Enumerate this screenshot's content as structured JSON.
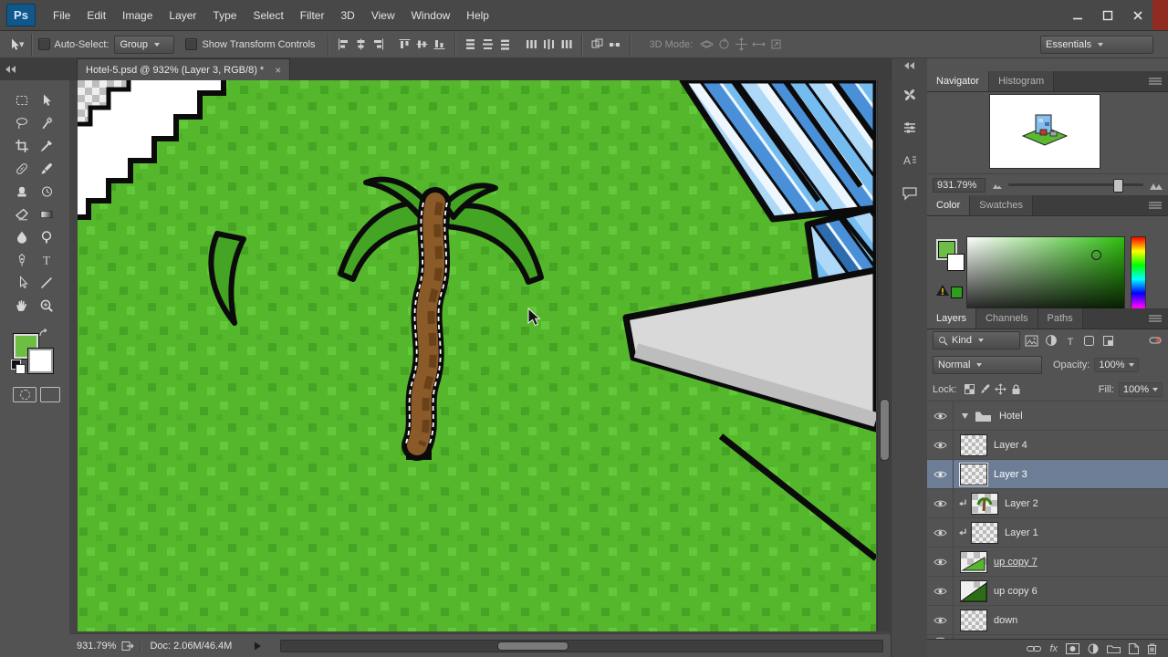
{
  "colors": {
    "grass": "#55b82c",
    "grass_dark": "#47a323",
    "grass_light": "#64c93a",
    "grass_mid": "#4fae27",
    "palm_leaf": "#43a523",
    "trunk": "#8a5a28",
    "trunk_dark": "#6b4118",
    "outline": "#0b0b0b",
    "glass_white": "#eef7fe",
    "glass_light": "#aed8f8",
    "glass_mid": "#74bbf0",
    "glass_deep": "#4a90d8",
    "glass_dark": "#2e6cb0",
    "concrete": "#d9d9d9",
    "concrete_shade": "#bdbdbd",
    "fg_swatch": "#6cbe45",
    "accent_selection": "#6d7d95"
  },
  "menu": {
    "logo": "Ps",
    "items": [
      "File",
      "Edit",
      "Image",
      "Layer",
      "Type",
      "Select",
      "Filter",
      "3D",
      "View",
      "Window",
      "Help"
    ]
  },
  "options": {
    "auto_select": "Auto-Select:",
    "group": "Group",
    "show_transform": "Show Transform Controls",
    "mode_3d": "3D Mode:",
    "workspace": "Essentials"
  },
  "tab": {
    "title": "Hotel-5.psd @ 932% (Layer 3, RGB/8) *",
    "close": "×"
  },
  "tools": [
    "rectangular-marquee",
    "move",
    "lasso",
    "magic-wand",
    "crop",
    "eyedropper",
    "spot-healing",
    "brush",
    "clone-stamp",
    "history-brush",
    "eraser",
    "gradient",
    "blur",
    "dodge",
    "pen",
    "type",
    "path-selection",
    "line",
    "hand",
    "zoom"
  ],
  "side_dock_icons": [
    "pinwheel-icon",
    "sliders-icon",
    "character-panel-icon",
    "notes-icon"
  ],
  "icons": {
    "type_glyph": "T",
    "fx_glyph": "fx"
  },
  "navigator": {
    "tab_navigator": "Navigator",
    "tab_histogram": "Histogram",
    "zoom": "931.79%"
  },
  "color": {
    "tab_color": "Color",
    "tab_swatches": "Swatches"
  },
  "layers": {
    "tab_layers": "Layers",
    "tab_channels": "Channels",
    "tab_paths": "Paths",
    "kind": "Kind",
    "blend_mode": "Normal",
    "opacity_label": "Opacity:",
    "opacity": "100%",
    "lock_label": "Lock:",
    "fill_label": "Fill:",
    "fill": "100%",
    "rows": [
      {
        "name": "Hotel"
      },
      {
        "name": "Layer 4"
      },
      {
        "name": "Layer 3"
      },
      {
        "name": "Layer 2"
      },
      {
        "name": "Layer 1"
      },
      {
        "name": "up copy 7"
      },
      {
        "name": "up copy 6"
      },
      {
        "name": "down"
      }
    ]
  },
  "status": {
    "zoom": "931.79%",
    "doc": "Doc: 2.06M/46.4M"
  }
}
